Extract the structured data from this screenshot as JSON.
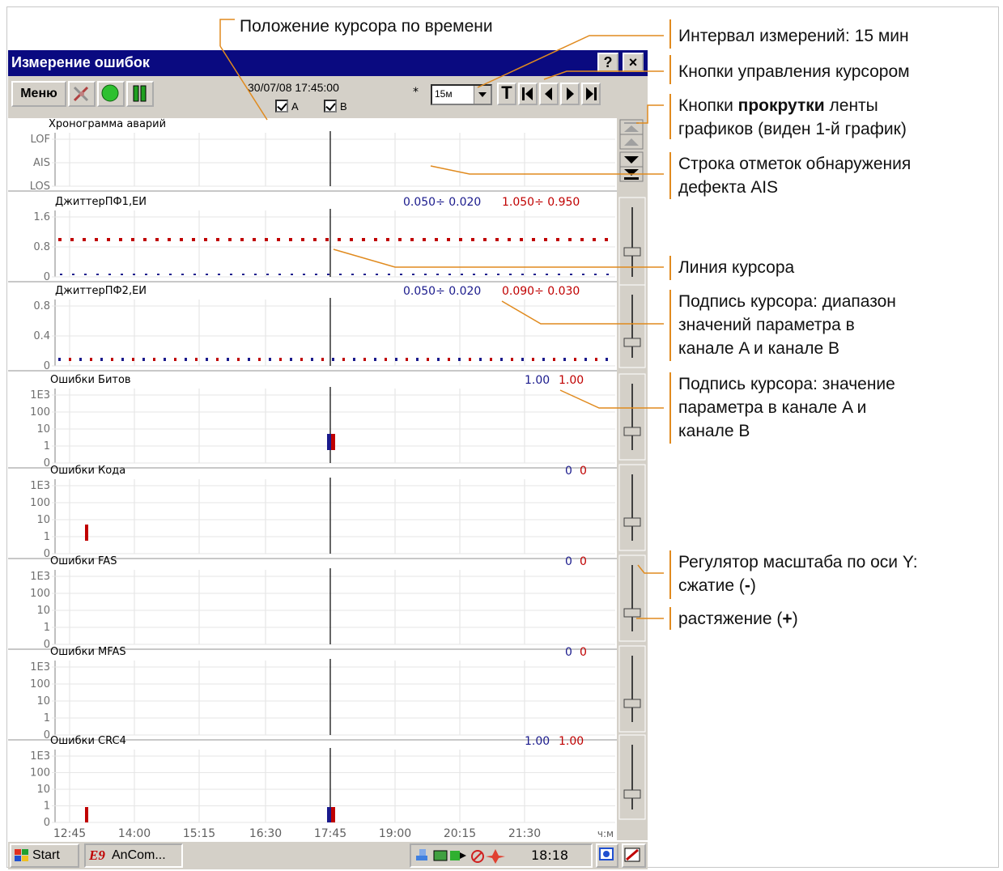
{
  "window": {
    "title": "Измерение ошибок",
    "help_label": "?",
    "close_label": "×"
  },
  "toolbar": {
    "menu_label": "Меню",
    "cursor_datetime": "30/07/08 17:45:00",
    "channel_a_label": "A",
    "channel_b_label": "B",
    "channel_a_checked": true,
    "channel_b_checked": true,
    "asterisk": "*",
    "interval_value": "15м",
    "t_label": "T"
  },
  "time_axis": {
    "ticks": [
      "12:45",
      "14:00",
      "15:15",
      "16:30",
      "17:45",
      "19:00",
      "20:15",
      "21:30"
    ],
    "unit": "ч:м"
  },
  "panels": [
    {
      "title": "Хронограмма аварий",
      "ylabels": [
        "LOF",
        "AIS",
        "LOS"
      ]
    },
    {
      "title": "ДжиттерПФ1,ЕИ",
      "range_a": "0.050÷ 0.020",
      "range_b": "1.050÷ 0.950",
      "ylabels": [
        "1.6",
        "0.8",
        "0"
      ]
    },
    {
      "title": "ДжиттерПФ2,ЕИ",
      "range_a": "0.050÷ 0.020",
      "range_b": "0.090÷ 0.030",
      "ylabels": [
        "0.8",
        "0.4",
        "0"
      ]
    },
    {
      "title": "Ошибки Битов",
      "value_a": "1.00",
      "value_b": "1.00",
      "ylabels": [
        "1E3",
        "100",
        "10",
        "1",
        "0"
      ]
    },
    {
      "title": "Ошибки Кода",
      "value_a": "0",
      "value_b": "0",
      "ylabels": [
        "1E3",
        "100",
        "10",
        "1",
        "0"
      ]
    },
    {
      "title": "Ошибки FAS",
      "value_a": "0",
      "value_b": "0",
      "ylabels": [
        "1E3",
        "100",
        "10",
        "1",
        "0"
      ]
    },
    {
      "title": "Ошибки MFAS",
      "value_a": "0",
      "value_b": "0",
      "ylabels": [
        "1E3",
        "100",
        "10",
        "1",
        "0"
      ]
    },
    {
      "title": "Ошибки CRC4",
      "value_a": "1.00",
      "value_b": "1.00",
      "ylabels": [
        "1E3",
        "100",
        "10",
        "1",
        "0"
      ]
    }
  ],
  "taskbar": {
    "start_label": "Start",
    "app_label": "AnCom...",
    "app_badge": "E9",
    "clock": "18:18"
  },
  "annotations": {
    "cursor_time": "Положение курсора по времени",
    "interval": "Интервал измерений: 15 мин",
    "cursor_buttons": "Кнопки управления курсором",
    "scroll_line1_prefix": "Кнопки ",
    "scroll_line1_bold": "прокрутки",
    "scroll_line1_suffix": " ленты",
    "scroll_line2": "графиков (виден 1-й график)",
    "ais_line1": "Строка отметок обнаружения",
    "ais_line2": "дефекта AIS",
    "cursor_line": "Линия курсора",
    "range_line1": "Подпись курсора: диапазон",
    "range_line2": "значений параметра в",
    "range_line3": "канале A и канале B",
    "value_line1": "Подпись курсора: значение",
    "value_line2": "параметра в канале A и",
    "value_line3": "канале B",
    "scale_line1": "Регулятор масштаба по оси Y:",
    "scale_line2_prefix": "сжатие (",
    "scale_line2_bold": "-",
    "scale_line2_suffix": ")",
    "stretch_prefix": "растяжение (",
    "stretch_bold": "+",
    "stretch_suffix": ")"
  },
  "colors": {
    "channel_a": "#1a1a8c",
    "channel_b": "#c00000",
    "titlebar": "#0a0a80"
  }
}
